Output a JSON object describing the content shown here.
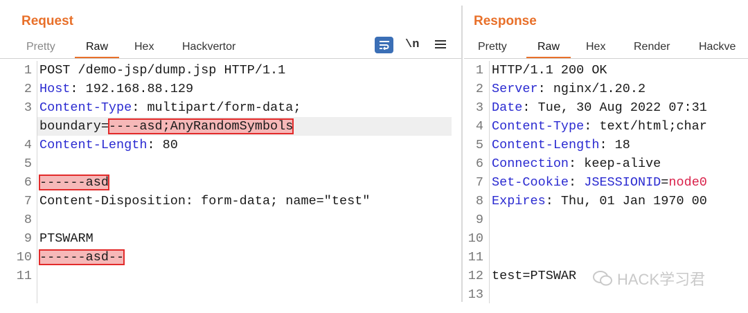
{
  "request": {
    "title": "Request",
    "tabs": [
      "Pretty",
      "Raw",
      "Hex",
      "Hackvertor"
    ],
    "active_tab": "Raw",
    "lines": [
      {
        "n": "1",
        "text": "POST /demo-jsp/dump.jsp HTTP/1.1"
      },
      {
        "n": "2",
        "key": "Host",
        "val": ": 192.168.88.129"
      },
      {
        "n": "3",
        "key": "Content-Type",
        "val": ": multipart/form-data;"
      },
      {
        "n": "",
        "pre": "boundary=",
        "hl": "----asd;AnyRandomSymbols"
      },
      {
        "n": "4",
        "key": "Content-Length",
        "val": ": 80"
      },
      {
        "n": "5",
        "text": ""
      },
      {
        "n": "6",
        "hl": "------asd"
      },
      {
        "n": "7",
        "text": "Content-Disposition: form-data; name=\"test\""
      },
      {
        "n": "8",
        "text": ""
      },
      {
        "n": "9",
        "text": "PTSWARM"
      },
      {
        "n": "10",
        "hl": "------asd--"
      },
      {
        "n": "11",
        "text": ""
      }
    ]
  },
  "response": {
    "title": "Response",
    "tabs": [
      "Pretty",
      "Raw",
      "Hex",
      "Render",
      "Hackve"
    ],
    "active_tab": "Raw",
    "lines": [
      {
        "n": "1",
        "text": "HTTP/1.1 200 OK"
      },
      {
        "n": "2",
        "key": "Server",
        "val": ": nginx/1.20.2"
      },
      {
        "n": "3",
        "key": "Date",
        "val": ": Tue, 30 Aug 2022 07:31"
      },
      {
        "n": "4",
        "key": "Content-Type",
        "val": ": text/html;char"
      },
      {
        "n": "5",
        "key": "Content-Length",
        "val": ": 18"
      },
      {
        "n": "6",
        "key": "Connection",
        "val": ": keep-alive"
      },
      {
        "n": "7",
        "key": "Set-Cookie",
        "val": ": ",
        "ckey": "JSESSIONID",
        "eq": "=",
        "cval": "node0"
      },
      {
        "n": "8",
        "key": "Expires",
        "val": ": Thu, 01 Jan 1970 00"
      },
      {
        "n": "9",
        "text": ""
      },
      {
        "n": "10",
        "text": ""
      },
      {
        "n": "11",
        "text": ""
      },
      {
        "n": "12",
        "text": "test=PTSWAR"
      },
      {
        "n": "13",
        "text": ""
      }
    ]
  },
  "toolbar": {
    "newline_label": "\\n"
  },
  "watermark": "HACK学习君",
  "colors": {
    "accent": "#e8702a",
    "header_key": "#2b2bd1",
    "cookie_value": "#d9214a",
    "highlight_fill": "#f6b8b8",
    "highlight_border": "#e22b2b"
  }
}
